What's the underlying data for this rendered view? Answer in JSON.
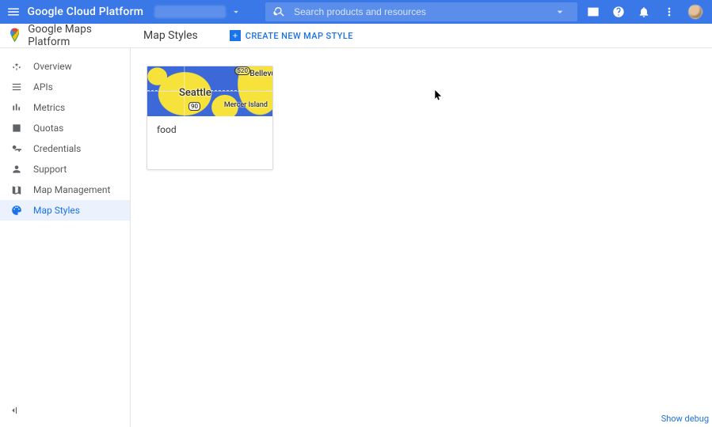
{
  "header": {
    "platform_name": "Google Cloud Platform",
    "search_placeholder": "Search products and resources"
  },
  "product": {
    "name": "Google Maps Platform",
    "page_title": "Map Styles",
    "create_label": "CREATE NEW MAP STYLE"
  },
  "sidebar": {
    "items": [
      {
        "id": "overview",
        "label": "Overview"
      },
      {
        "id": "apis",
        "label": "APIs"
      },
      {
        "id": "metrics",
        "label": "Metrics"
      },
      {
        "id": "quotas",
        "label": "Quotas"
      },
      {
        "id": "credentials",
        "label": "Credentials"
      },
      {
        "id": "support",
        "label": "Support"
      },
      {
        "id": "map-mgmt",
        "label": "Map Management"
      },
      {
        "id": "map-styles",
        "label": "Map Styles"
      }
    ],
    "active": "map-styles"
  },
  "styles": [
    {
      "name": "food",
      "thumb_labels": {
        "city": "Seattle",
        "ne": "Bellevu",
        "island": "Mercer Island",
        "route": "520",
        "shield": "90"
      }
    }
  ],
  "footer": {
    "debug": "Show debug"
  }
}
